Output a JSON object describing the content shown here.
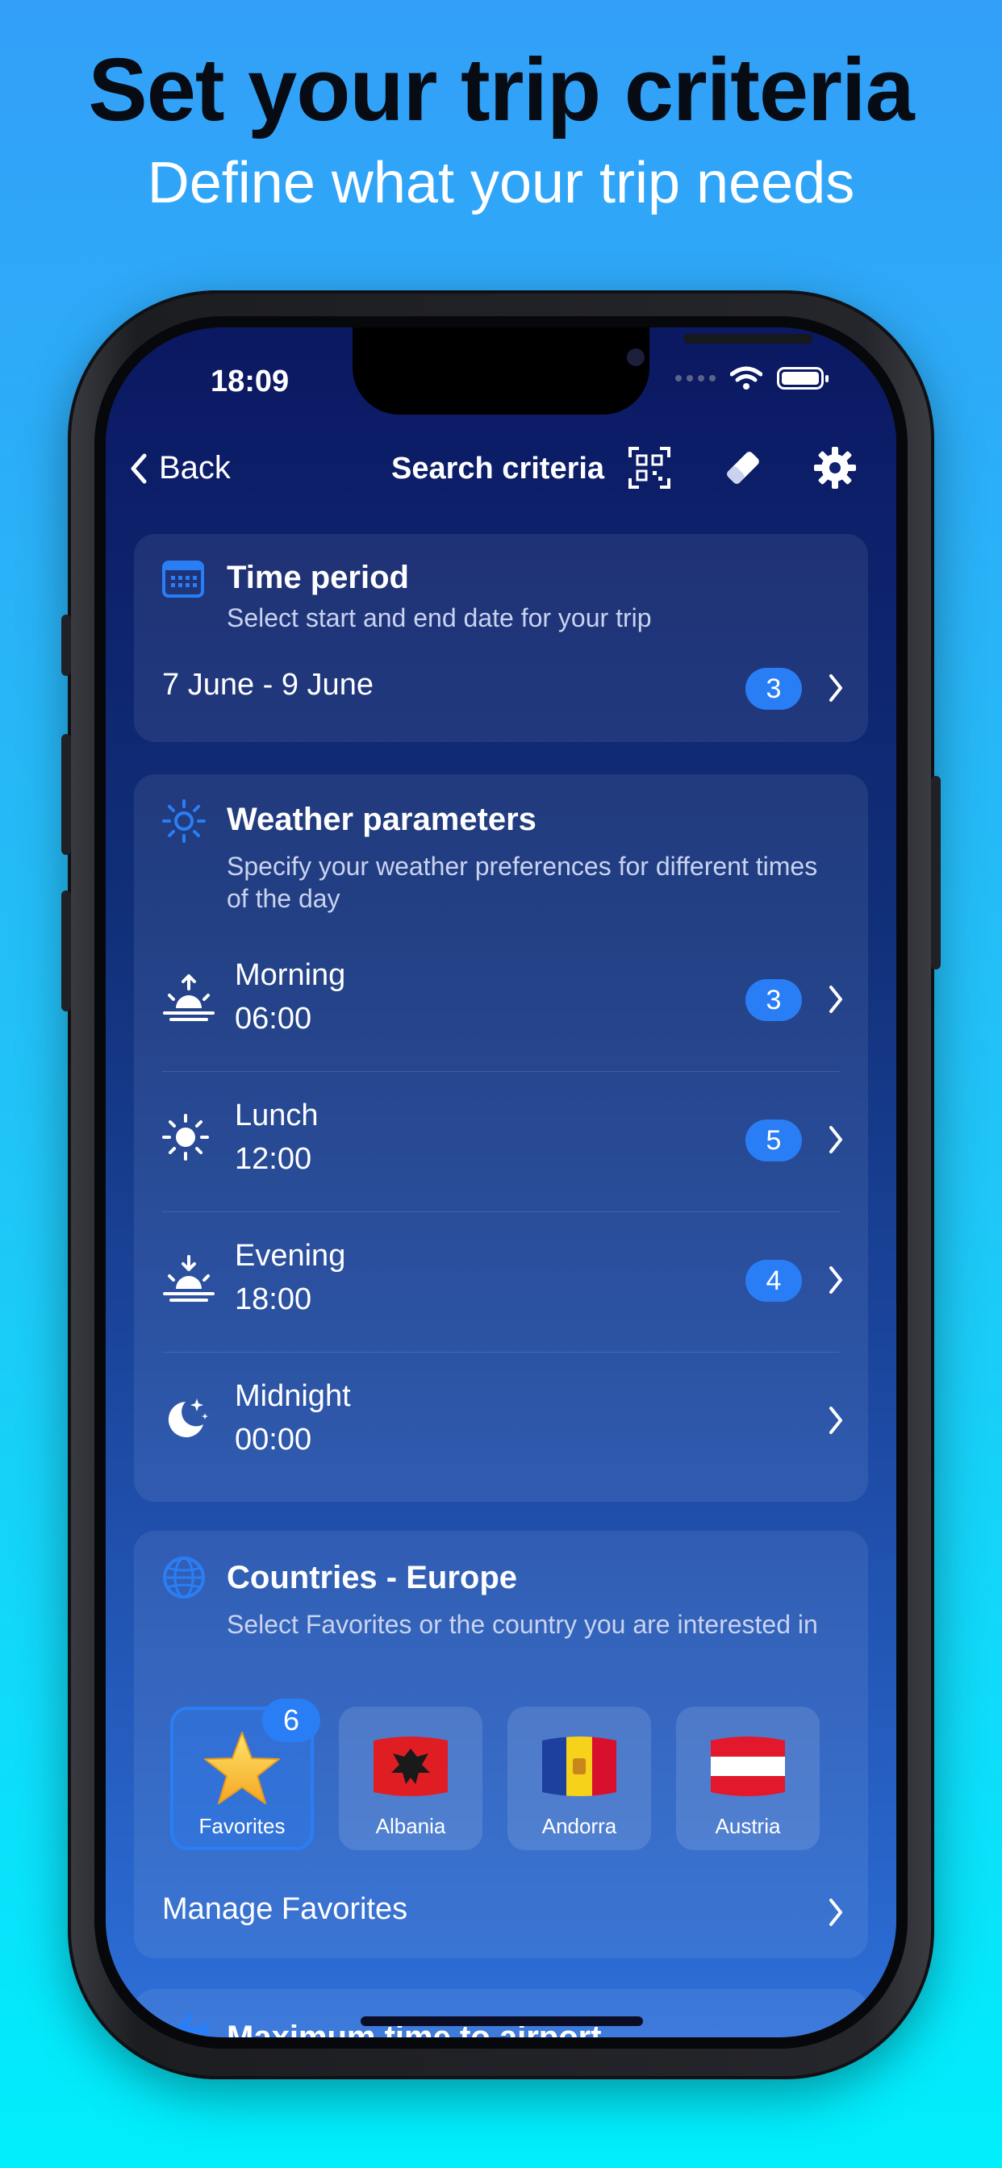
{
  "promo": {
    "headline": "Set your trip criteria",
    "subheadline": "Define what your trip needs"
  },
  "status_bar": {
    "time": "18:09"
  },
  "nav": {
    "back_label": "Back",
    "title": "Search criteria",
    "icons": [
      "qr-code-icon",
      "eraser-icon",
      "gear-icon"
    ]
  },
  "time_period": {
    "title": "Time period",
    "subtitle": "Select start and end date for your trip",
    "value": "7 June - 9 June",
    "count": "3"
  },
  "weather": {
    "title": "Weather parameters",
    "subtitle": "Specify your weather preferences for different times of the day",
    "rows": [
      {
        "name": "Morning",
        "time": "06:00",
        "count": "3",
        "icon": "sunrise-icon"
      },
      {
        "name": "Lunch",
        "time": "12:00",
        "count": "5",
        "icon": "sun-icon"
      },
      {
        "name": "Evening",
        "time": "18:00",
        "count": "4",
        "icon": "sunset-icon"
      },
      {
        "name": "Midnight",
        "time": "00:00",
        "count": "",
        "icon": "moon-stars-icon"
      }
    ]
  },
  "countries": {
    "title": "Countries - Europe",
    "subtitle": "Select Favorites or the country you are interested in",
    "tiles": [
      {
        "label": "Favorites",
        "badge": "6",
        "selected": true
      },
      {
        "label": "Albania"
      },
      {
        "label": "Andorra"
      },
      {
        "label": "Austria"
      }
    ],
    "manage_label": "Manage Favorites"
  },
  "next_section": {
    "title": "Maximum time to airport"
  },
  "colors": {
    "accent": "#2a7ef5",
    "headline": "#070b14",
    "bg_top": "#339ff8",
    "bg_bottom": "#00eefc"
  }
}
